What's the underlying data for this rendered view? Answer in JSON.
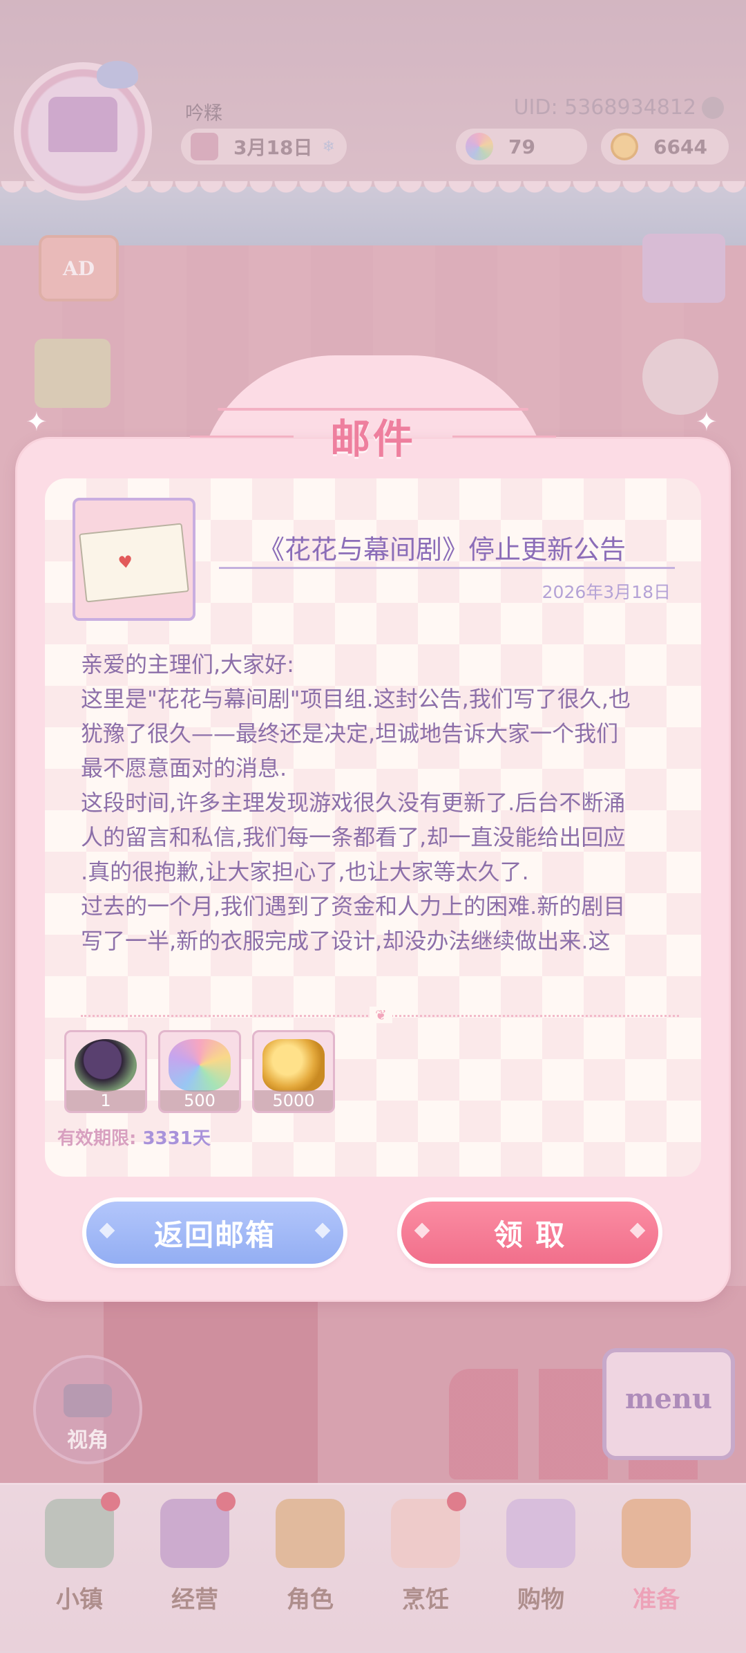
{
  "hud": {
    "player_name": "吟糅",
    "uid": "UID: 5368934812",
    "date": "3月18日",
    "flowers": "79",
    "coins": "6644",
    "ad_label": "AD"
  },
  "mail": {
    "title": "邮件",
    "subject": "《花花与幕间剧》停止更新公告",
    "date": "2026年3月18日",
    "body_lines": [
      "亲爱的主理们,大家好:",
      "这里是\"花花与幕间剧\"项目组.这封公告,我们写了很久,也",
      "犹豫了很久——最终还是决定,坦诚地告诉大家一个我们",
      "最不愿意面对的消息.",
      "这段时间,许多主理发现游戏很久没有更新了.后台不断涌",
      "人的留言和私信,我们每一条都看了,却一直没能给出回应",
      ".真的很抱歉,让大家担心了,也让大家等太久了.",
      "过去的一个月,我们遇到了资金和人力上的困难.新的剧目",
      "写了一半,新的衣服完成了设计,却没办法继续做出来.这"
    ],
    "rewards": [
      {
        "icon": "hat-item-icon",
        "qty": "1"
      },
      {
        "icon": "rainbow-petal-icon",
        "qty": "500"
      },
      {
        "icon": "gold-coins-icon",
        "qty": "5000"
      }
    ],
    "validity_label": "有效期限:",
    "validity_days": "3331天",
    "back_button": "返回邮箱",
    "claim_button": "领 取"
  },
  "side": {
    "camera_label": "视角",
    "menu_label": "menu"
  },
  "nav": {
    "items": [
      {
        "label": "小镇",
        "icon": "town-map-icon",
        "badge": true
      },
      {
        "label": "经营",
        "icon": "top-hat-icon",
        "badge": true
      },
      {
        "label": "角色",
        "icon": "character-icon",
        "badge": false
      },
      {
        "label": "烹饪",
        "icon": "sandwich-icon",
        "badge": true
      },
      {
        "label": "购物",
        "icon": "shopping-bag-icon",
        "badge": false
      },
      {
        "label": "准备",
        "icon": "basket-icon",
        "badge": false,
        "active": true
      }
    ]
  },
  "colors": {
    "accent_pink": "#ee7f9e",
    "text_purple": "#8c6fa9",
    "button_blue": "#a3bbf7",
    "button_pink": "#f47c95",
    "badge_red": "#d63b4f"
  }
}
